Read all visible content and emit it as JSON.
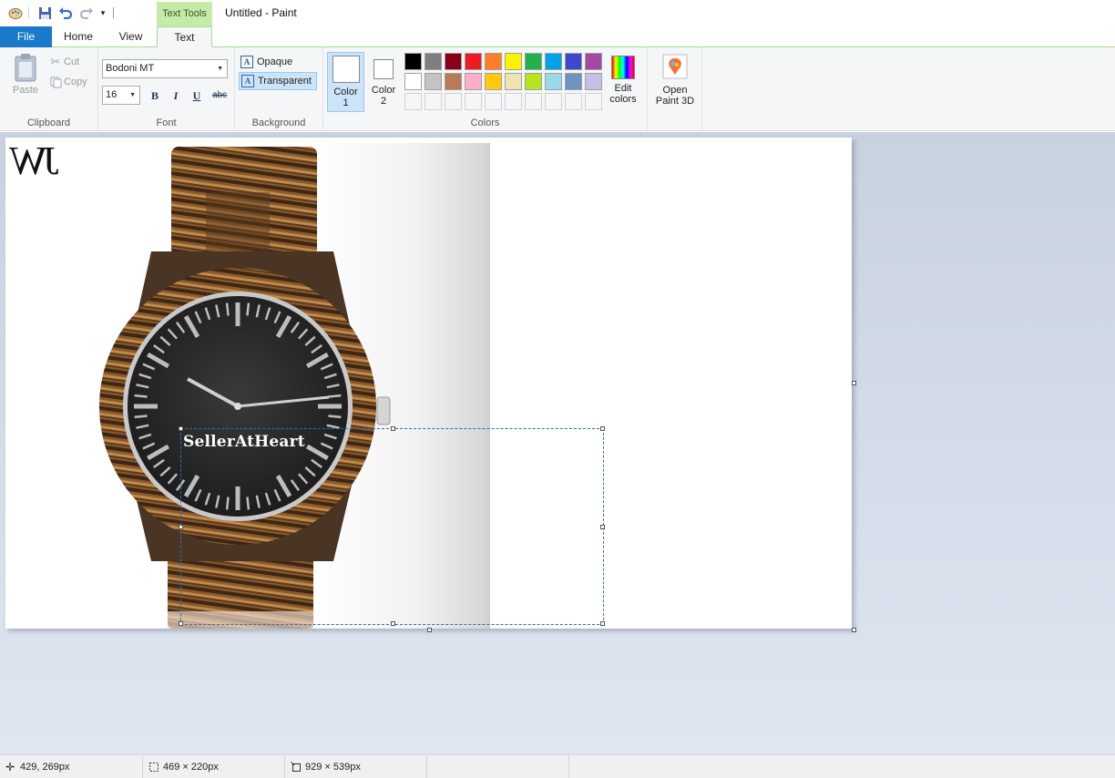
{
  "window": {
    "title": "Untitled - Paint",
    "contextual_tab": "Text Tools"
  },
  "quick_access": [
    {
      "name": "paint-icon"
    },
    {
      "name": "save-icon"
    },
    {
      "name": "undo-icon"
    },
    {
      "name": "redo-icon"
    },
    {
      "name": "customize-icon"
    }
  ],
  "tabs": [
    {
      "label": "File",
      "active": false
    },
    {
      "label": "Home",
      "active": false
    },
    {
      "label": "View",
      "active": false
    },
    {
      "label": "Text",
      "active": true
    }
  ],
  "ribbon": {
    "clipboard": {
      "paste": "Paste",
      "cut": "Cut",
      "copy": "Copy",
      "label": "Clipboard"
    },
    "font": {
      "family": "Bodoni MT",
      "size": "16",
      "bold": "B",
      "italic": "I",
      "underline": "U",
      "strikethrough": "abc",
      "label": "Font"
    },
    "background": {
      "opaque": "Opaque",
      "transparent": "Transparent",
      "selected": "transparent",
      "label": "Background"
    },
    "colors": {
      "color1": "Color 1",
      "color2": "Color 2",
      "color1_value": "#ffffff",
      "color2_value": "#ffffff",
      "palette_row1": [
        "#000000",
        "#7f7f7f",
        "#880015",
        "#ed1c24",
        "#ff7f27",
        "#fff200",
        "#22b14c",
        "#00a2e8",
        "#3f48cc",
        "#a349a4"
      ],
      "palette_row2": [
        "#ffffff",
        "#c3c3c3",
        "#b97a57",
        "#ffaec9",
        "#ffc90e",
        "#efe4b0",
        "#b5e61d",
        "#99d9ea",
        "#7092be",
        "#c8bfe7"
      ],
      "palette_row3": [
        "#f5f6f7",
        "#f5f6f7",
        "#f5f6f7",
        "#f5f6f7",
        "#f5f6f7",
        "#f5f6f7",
        "#f5f6f7",
        "#f5f6f7",
        "#f5f6f7",
        "#f5f6f7"
      ],
      "edit": "Edit colors",
      "label": "Colors"
    },
    "paint3d": {
      "label": "Open Paint 3D"
    }
  },
  "canvas": {
    "logo_text": "JW",
    "text_box_content": "SellerAtHeart",
    "image_subject": "wooden-wristwatch"
  },
  "status": {
    "cursor": "429, 269px",
    "selection": "469 × 220px",
    "image_size": "929 × 539px"
  }
}
